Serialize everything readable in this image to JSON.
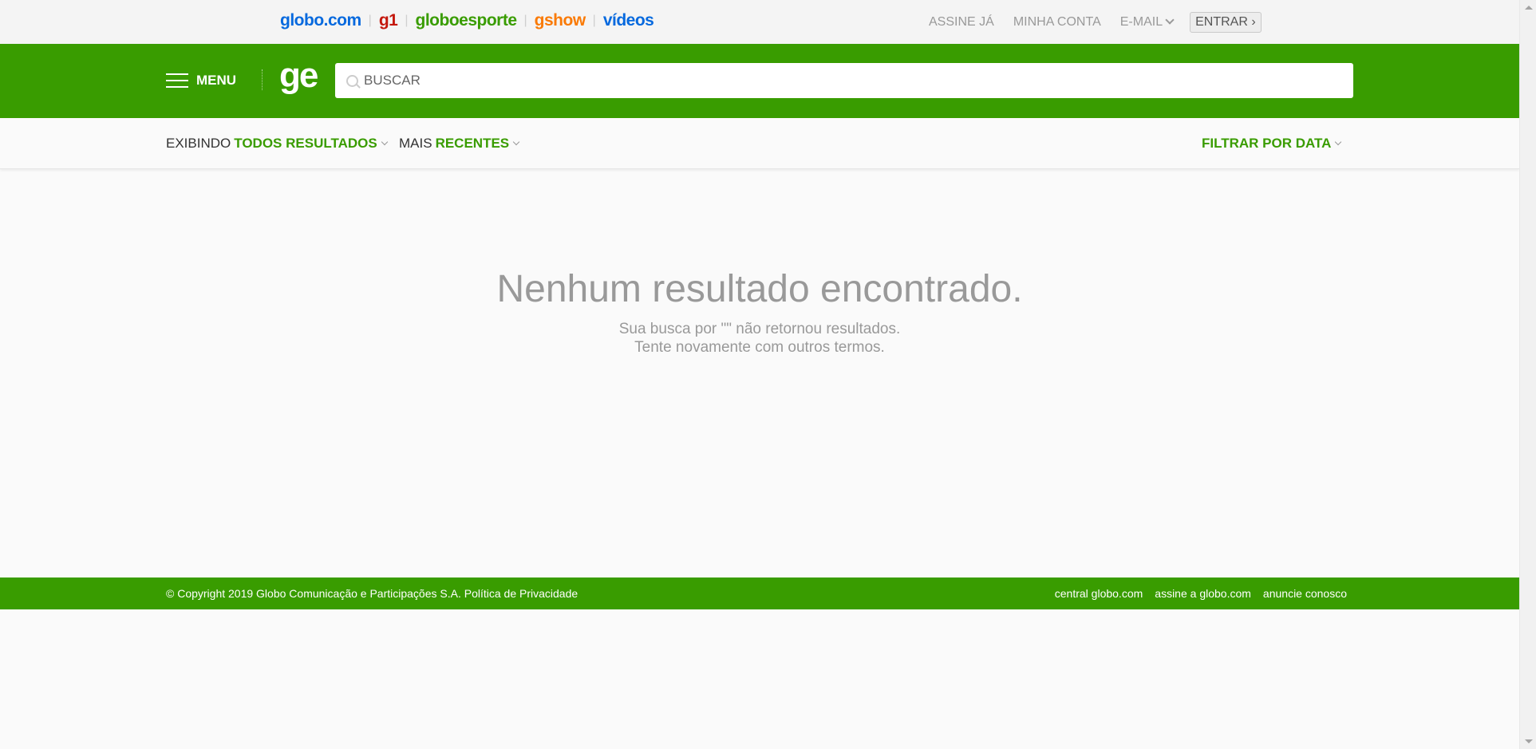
{
  "topbar": {
    "brands": [
      {
        "label": "globo.com",
        "color": "#0669de"
      },
      {
        "label": "g1",
        "color": "#c4170c"
      },
      {
        "label": "globoesporte",
        "color": "#399c00"
      },
      {
        "label": "gshow",
        "color": "#fa7a05"
      },
      {
        "label": "vídeos",
        "color": "#0669de"
      }
    ],
    "links": {
      "assine": "ASSINE JÁ",
      "conta": "MINHA CONTA",
      "email": "E-MAIL",
      "entrar": "ENTRAR ›"
    }
  },
  "header": {
    "menu_label": "MENU",
    "logo": "ge",
    "search_placeholder": "BUSCAR",
    "search_value": "",
    "icon": "search-icon"
  },
  "filters": {
    "show_prefix": "EXIBINDO",
    "show_value": "TODOS RESULTADOS",
    "order_prefix": "MAIS",
    "order_value": "RECENTES",
    "date_value": "FILTRAR POR DATA"
  },
  "empty": {
    "title": "Nenhum resultado encontrado.",
    "line1": "Sua busca por \"\" não retornou resultados.",
    "line2": "Tente novamente com outros termos."
  },
  "footer": {
    "copyright": "© Copyright 2019 Globo Comunicação e Participações S.A. Política de Privacidade",
    "links": [
      "central globo.com",
      "assine a globo.com",
      "anuncie conosco"
    ]
  },
  "colors": {
    "brand_green": "#399c00",
    "muted_text": "#999999"
  }
}
